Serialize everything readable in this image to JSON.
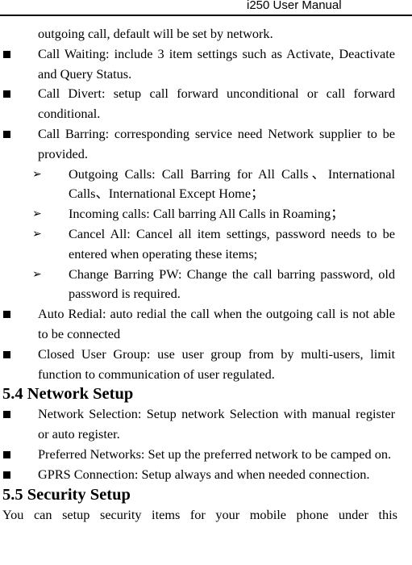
{
  "header": {
    "title": "i250 User Manual"
  },
  "continuation": "outgoing call, default will be set by network.",
  "items_a": [
    {
      "text": "Call Waiting: include 3 item settings such as Activate, Deactivate and Query Status."
    },
    {
      "text": "Call Divert: setup call forward unconditional or call forward conditional."
    },
    {
      "text": "Call Barring: corresponding service need Network supplier to be provided."
    }
  ],
  "barring_sub_items": [
    {
      "text": "Outgoing Calls: Call Barring for All Calls、International Calls、International Except Home；"
    },
    {
      "text": "Incoming calls: Call barring All Calls in Roaming；"
    },
    {
      "text": "Cancel All: Cancel all item settings, password needs to be entered when operating these items;"
    },
    {
      "text": "Change Barring PW: Change the call barring password, old password is required."
    }
  ],
  "items_b": [
    {
      "text": "Auto Redial: auto redial the call when the outgoing call is not able to be connected"
    },
    {
      "text": "Closed User Group: use user group from by multi-users, limit function to communication of user regulated."
    }
  ],
  "section_network": {
    "heading": "5.4 Network Setup",
    "items": [
      {
        "text": "Network Selection: Setup network Selection with manual register or auto register."
      },
      {
        "text": "Preferred Networks: Set up the preferred network to be camped on."
      },
      {
        "text": "GPRS Connection: Setup always and when needed connection."
      }
    ]
  },
  "section_security": {
    "heading": "5.5 Security Setup",
    "intro": "You can setup security items for your mobile phone under this"
  }
}
